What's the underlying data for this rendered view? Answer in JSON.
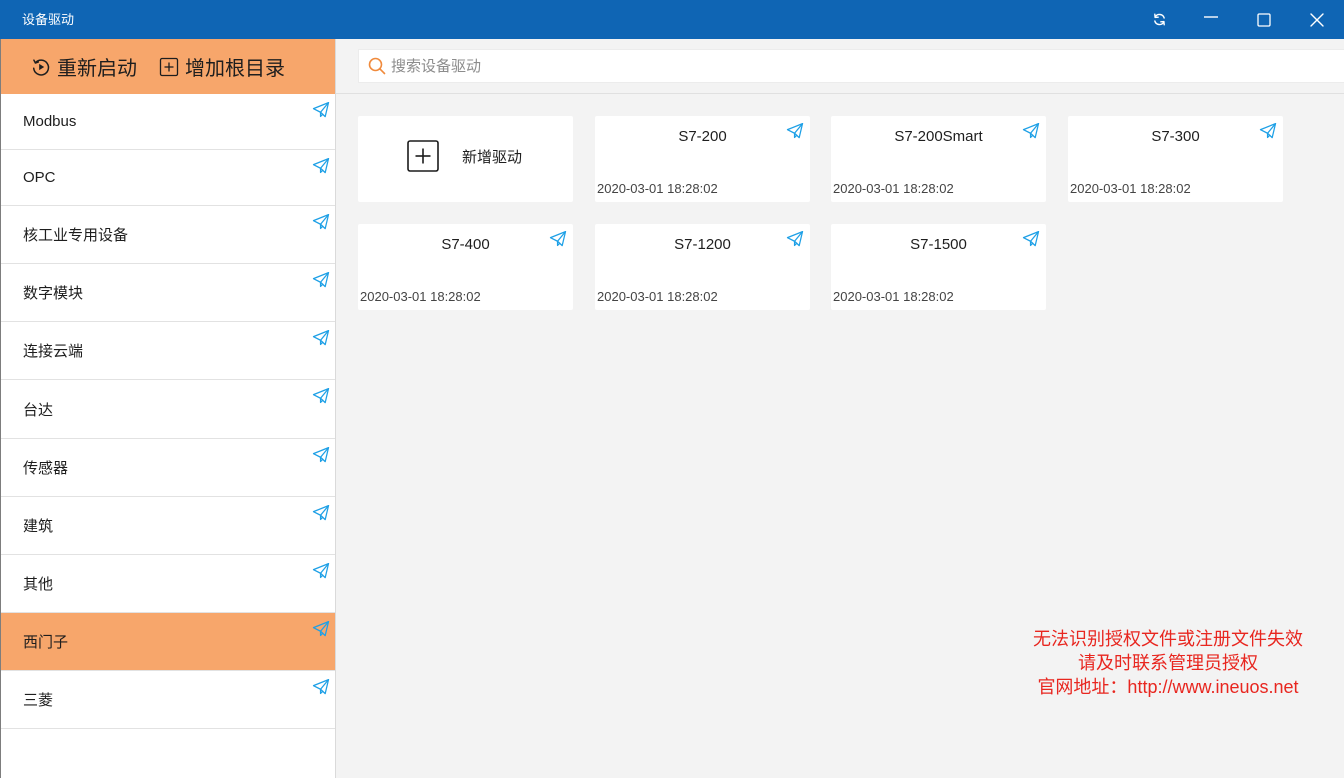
{
  "window": {
    "title": "设备驱动",
    "controls": {
      "refresh": "refresh-icon",
      "minimize": "minimize-icon",
      "maximize": "maximize-icon",
      "close": "close-icon"
    }
  },
  "colors": {
    "titlebar": "#0f65b4",
    "accent_orange": "#f7a66b",
    "icon_blue": "#1ea0e6",
    "search_icon_orange": "#f08a3c",
    "notice_red": "#e8261f",
    "content_bg": "#f3f3f3"
  },
  "sidebar": {
    "toolbar": {
      "restart": {
        "label": "重新启动",
        "icon": "restart-icon"
      },
      "add_root": {
        "label": "增加根目录",
        "icon": "add-square-icon"
      }
    },
    "item_icon": "paper-plane-icon",
    "selected_index": 9,
    "items": [
      {
        "label": "Modbus"
      },
      {
        "label": "OPC"
      },
      {
        "label": "核工业专用设备"
      },
      {
        "label": "数字模块"
      },
      {
        "label": "连接云端"
      },
      {
        "label": "台达"
      },
      {
        "label": "传感器"
      },
      {
        "label": "建筑"
      },
      {
        "label": "其他"
      },
      {
        "label": "西门子"
      },
      {
        "label": "三菱"
      }
    ]
  },
  "search": {
    "placeholder": "搜索设备驱动",
    "value": "",
    "icon": "search-icon"
  },
  "add_driver_card": {
    "label": "新增驱动",
    "icon": "add-square-icon"
  },
  "drivers": [
    {
      "name": "S7-200",
      "date": "2020-03-01 18:28:02"
    },
    {
      "name": "S7-200Smart",
      "date": "2020-03-01 18:28:02"
    },
    {
      "name": "S7-300",
      "date": "2020-03-01 18:28:02"
    },
    {
      "name": "S7-400",
      "date": "2020-03-01 18:28:02"
    },
    {
      "name": "S7-1200",
      "date": "2020-03-01 18:28:02"
    },
    {
      "name": "S7-1500",
      "date": "2020-03-01 18:28:02"
    }
  ],
  "license_notice": [
    "无法识别授权文件或注册文件失效",
    "请及时联系管理员授权",
    "官网地址：http://www.ineuos.net"
  ]
}
